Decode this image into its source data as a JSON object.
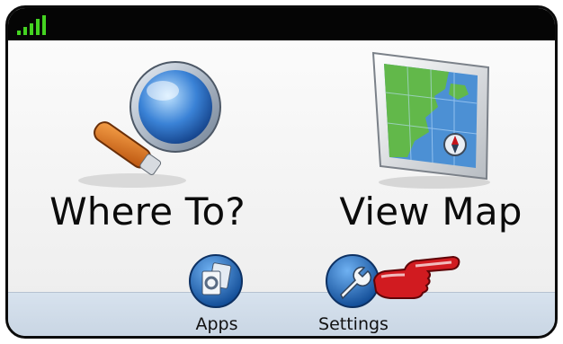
{
  "status_bar": {
    "signal_icon": "signal-strength-icon",
    "accent": "#3fcc1f"
  },
  "main": {
    "where_to": {
      "label": "Where To?",
      "icon": "magnifying-glass-icon"
    },
    "view_map": {
      "label": "View Map",
      "icon": "map-icon"
    }
  },
  "bottom_bar": {
    "apps": {
      "label": "Apps",
      "icon": "apps-icon"
    },
    "settings": {
      "label": "Settings",
      "icon": "wrench-icon"
    }
  },
  "pointer": {
    "icon": "pointing-hand-icon",
    "color": "#c4141b"
  }
}
